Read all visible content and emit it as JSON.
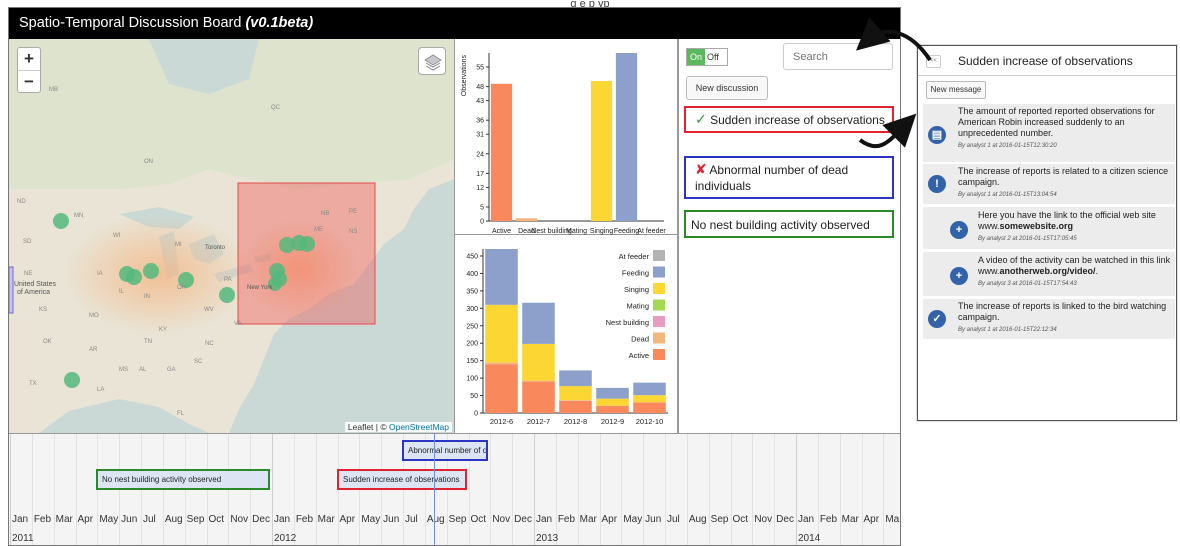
{
  "caption_fragment": "g   e                   p     yp",
  "app": {
    "title_prefix": "Spatio-Temporal Discussion Board",
    "title_version": "(v0.1beta)"
  },
  "map": {
    "zoom_in": "+",
    "zoom_out": "−",
    "attribution_prefix": "Leaflet | ©",
    "attribution_link": "OpenStreetMap",
    "labels": [
      {
        "text": "MB"
      },
      {
        "text": "ON"
      },
      {
        "text": "QC"
      },
      {
        "text": "ND"
      },
      {
        "text": "MN"
      },
      {
        "text": "SD"
      },
      {
        "text": "WI"
      },
      {
        "text": "MI"
      },
      {
        "text": "NE"
      },
      {
        "text": "IA"
      },
      {
        "text": "IL"
      },
      {
        "text": "IN"
      },
      {
        "text": "OH"
      },
      {
        "text": "PA"
      },
      {
        "text": "WV"
      },
      {
        "text": "VA"
      },
      {
        "text": "KY"
      },
      {
        "text": "MO"
      },
      {
        "text": "KS"
      },
      {
        "text": "OK"
      },
      {
        "text": "AR"
      },
      {
        "text": "TN"
      },
      {
        "text": "NC"
      },
      {
        "text": "SC"
      },
      {
        "text": "MS"
      },
      {
        "text": "AL"
      },
      {
        "text": "GA"
      },
      {
        "text": "TX"
      },
      {
        "text": "LA"
      },
      {
        "text": "FL"
      },
      {
        "text": "NB"
      },
      {
        "text": "NS"
      },
      {
        "text": "ME"
      },
      {
        "text": "PE"
      }
    ],
    "cities": [
      {
        "text": "Toronto"
      },
      {
        "text": "New York"
      },
      {
        "text": "United States"
      },
      {
        "text": "of America"
      }
    ]
  },
  "chart_data": [
    {
      "type": "bar",
      "ylabel": "Observations",
      "categories": [
        "Active",
        "Dead",
        "Nest building",
        "Mating",
        "Singing",
        "Feeding",
        "At feeder"
      ],
      "tick_display": [
        "Active",
        "Dead",
        "Nest building",
        "Mating",
        "Singing",
        "Feeding",
        "At feeder"
      ],
      "values": [
        49,
        1,
        0,
        0,
        50,
        60,
        0
      ],
      "colors": [
        "#f9895c",
        "#f3b77e",
        "#e79dc2",
        "#a5d852",
        "#fcd733",
        "#8da0cb",
        "#b3b3b3"
      ],
      "ylim": [
        0,
        60
      ],
      "yticks": [
        0,
        5,
        12,
        17,
        24,
        31,
        36,
        43,
        48,
        55
      ],
      "grid": false
    },
    {
      "type": "bar",
      "stacked": true,
      "categories": [
        "2012-6",
        "2012-7",
        "2012-8",
        "2012-9",
        "2012-10"
      ],
      "series": [
        {
          "name": "Active",
          "color": "#f9895c",
          "values": [
            140,
            90,
            35,
            20,
            30
          ]
        },
        {
          "name": "Dead",
          "color": "#f3b77e",
          "values": [
            5,
            3,
            2,
            1,
            1
          ]
        },
        {
          "name": "Nest building",
          "color": "#e79dc2",
          "values": [
            0,
            0,
            0,
            0,
            0
          ]
        },
        {
          "name": "Mating",
          "color": "#a5d852",
          "values": [
            0,
            0,
            0,
            0,
            0
          ]
        },
        {
          "name": "Singing",
          "color": "#fcd733",
          "values": [
            165,
            105,
            40,
            20,
            20
          ]
        },
        {
          "name": "Feeding",
          "color": "#8da0cb",
          "values": [
            160,
            118,
            45,
            31,
            36
          ]
        },
        {
          "name": "At feeder",
          "color": "#b3b3b3",
          "values": [
            0,
            0,
            0,
            0,
            0
          ]
        }
      ],
      "legend_order": [
        "At feeder",
        "Feeding",
        "Singing",
        "Mating",
        "Nest building",
        "Dead",
        "Active"
      ],
      "ylim": [
        0,
        470
      ],
      "yticks": [
        0,
        50,
        100,
        150,
        200,
        250,
        300,
        350,
        400,
        450
      ],
      "legend": "top-right",
      "grid": false
    }
  ],
  "discussions": {
    "toggle_on": "On",
    "toggle_off": "Off",
    "search_placeholder": "Search",
    "new_label": "New discussion",
    "items": [
      {
        "marker": "✓",
        "text": "Sudden increase of observations",
        "border": "#e0232e",
        "marker_color": "#2f9e3d"
      },
      {
        "marker": "✘",
        "text": "Abnormal number of dead individuals",
        "border": "#2b35c4",
        "marker_color": "#e0232e"
      },
      {
        "marker": "",
        "text": "No nest building activity observed",
        "border": "#2a8a2a",
        "marker_color": "#222"
      }
    ]
  },
  "timeline": {
    "events": [
      {
        "text": "Abnormal number of d",
        "border": "#2b35c4"
      },
      {
        "text": "No nest building activity observed",
        "border": "#2a8a2a"
      },
      {
        "text": "Sudden increase of observations",
        "border": "#e0232e"
      }
    ],
    "months": [
      "Jan",
      "Feb",
      "Mar",
      "Apr",
      "May",
      "Jun",
      "Jul",
      "Aug",
      "Sep",
      "Oct",
      "Nov",
      "Dec",
      "Jan",
      "Feb",
      "Mar",
      "Apr",
      "May",
      "Jun",
      "Jul",
      "Aug",
      "Sep",
      "Oct",
      "Nov",
      "Dec",
      "Jan",
      "Feb",
      "Mar",
      "Apr",
      "May",
      "Jun",
      "Jul",
      "Aug",
      "Sep",
      "Oct",
      "Nov",
      "Dec",
      "Jan",
      "Feb",
      "Mar",
      "Apr",
      "Ma"
    ],
    "years": [
      "2011",
      "2012",
      "2013",
      "2014"
    ]
  },
  "detail": {
    "back_label": "<<",
    "title": "Sudden increase of observations",
    "new_message": "New message",
    "messages": [
      {
        "icon": "book",
        "glyph": "▤",
        "text": "The amount of reported reported observations for American Robin increased suddenly to an unprecedented number.",
        "meta": "By analyst 1 at 2016-01-15T12:30:20"
      },
      {
        "icon": "lightbulb",
        "glyph": "!",
        "text": "The increase of reports is related to a citizen science campaign.",
        "meta": "By analyst 1 at 2016-01-15T13:04:54"
      },
      {
        "icon": "plus",
        "glyph": "+",
        "pre": "Here you have the link to the official web site www.",
        "link": "somewebsite.org",
        "post": "",
        "meta": "By analyst 2 at 2016-01-15T17:05:45"
      },
      {
        "icon": "plus",
        "glyph": "+",
        "pre": "A video of the activity can be watched in this link www.",
        "link": "anotherweb.org/video/",
        "post": ".",
        "meta": "By analyst 3 at 2016-01-15T17:54:43"
      },
      {
        "icon": "check",
        "glyph": "✓",
        "text": "The increase of reports is linked to the bird watching campaign.",
        "meta": "By analyst 1 at 2016-01-15T22:12:34"
      }
    ]
  }
}
